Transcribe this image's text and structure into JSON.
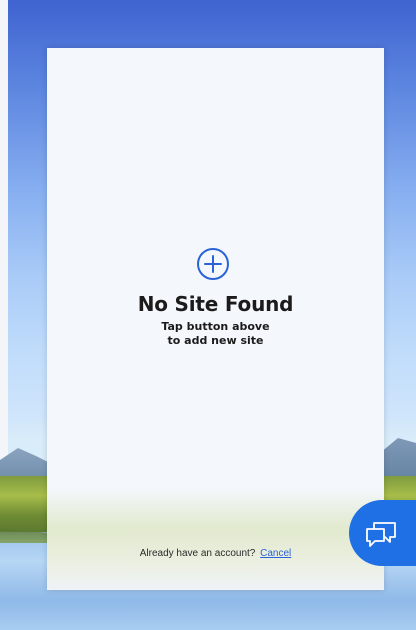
{
  "empty_state": {
    "title": "No Site Found",
    "subtitle_line1": "Tap button above",
    "subtitle_line2": "to add new site",
    "add_icon": "plus-circle-icon"
  },
  "footer": {
    "prompt": "Already have an account?",
    "cancel_link": "Cancel"
  },
  "chat": {
    "icon": "chat-bubbles-icon"
  },
  "colors": {
    "accent": "#1f6fe5",
    "link": "#2a63d8",
    "card_background": "#f4f7fb",
    "text": "#1b1b1b"
  }
}
